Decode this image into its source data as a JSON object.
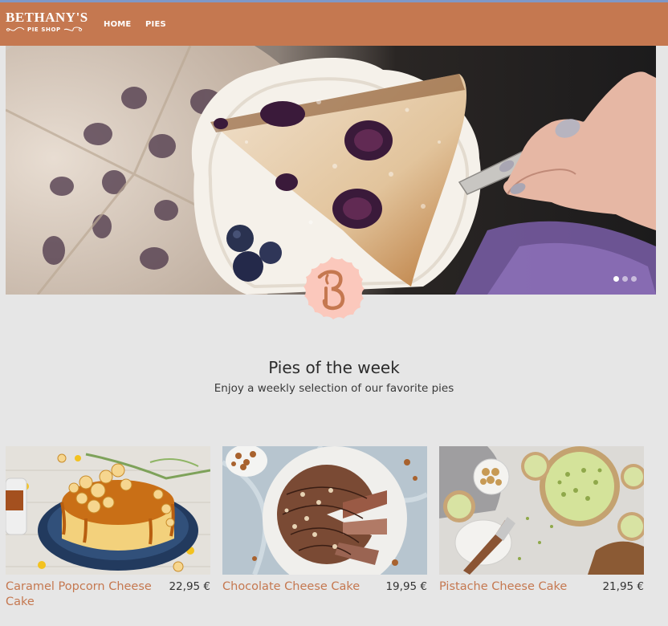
{
  "brand": {
    "name": "BETHANY'S",
    "subtitle": "PIE SHOP",
    "primary_color": "#c57850"
  },
  "nav": {
    "links": [
      "HOME",
      "PIES"
    ]
  },
  "hero": {
    "slides_total": 3,
    "active_slide": 1
  },
  "section": {
    "title": "Pies of the week",
    "subtitle": "Enjoy a weekly selection of our favorite pies"
  },
  "products": [
    {
      "name": "Caramel Popcorn Cheese Cake",
      "price": "22,95 €"
    },
    {
      "name": "Chocolate Cheese Cake",
      "price": "19,95 €"
    },
    {
      "name": "Pistache Cheese Cake",
      "price": "21,95 €"
    }
  ]
}
